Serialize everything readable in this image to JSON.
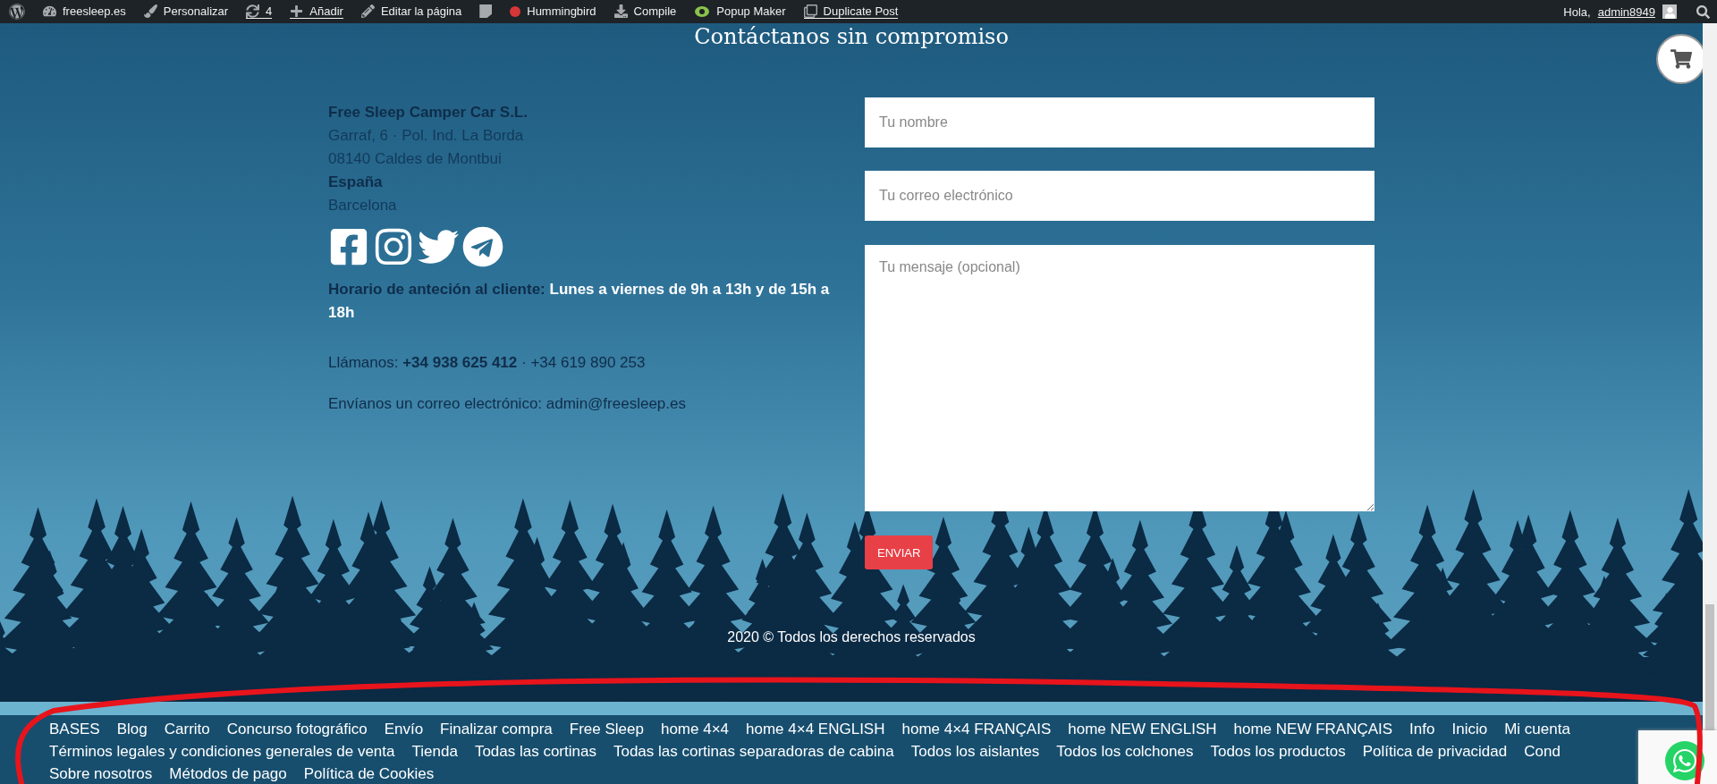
{
  "admin_bar": {
    "items": [
      {
        "kind": "wordpress",
        "underlined": false
      },
      {
        "kind": "dashboard",
        "label": "freesleep.es",
        "underlined": false
      },
      {
        "kind": "brush",
        "label": "Personalizar",
        "underlined": false
      },
      {
        "kind": "updates",
        "label": "4",
        "underlined": true
      },
      {
        "kind": "add",
        "label": "Añadir",
        "underlined": true
      },
      {
        "kind": "edit",
        "label": "Editar la página",
        "underlined": false
      },
      {
        "kind": "yoast",
        "underlined": false
      },
      {
        "kind": "status",
        "label": "Hummingbird",
        "underlined": false
      },
      {
        "kind": "compile",
        "label": "Compile",
        "underlined": false
      },
      {
        "kind": "popup",
        "label": "Popup Maker",
        "underlined": false
      },
      {
        "kind": "duplicate",
        "label": "Duplicate Post",
        "underlined": true
      }
    ],
    "greeting": "Hola,",
    "user": "admin8949"
  },
  "heading": "Contáctanos sin compromiso",
  "contact": {
    "address_lines": [
      {
        "text": "Free Sleep Camper Car S.L.",
        "bold": true
      },
      {
        "text": "Garraf, 6 · Pol. Ind. La Borda",
        "bold": false
      },
      {
        "text": "08140 Caldes de Montbui",
        "bold": false
      },
      {
        "text": "España",
        "bold": true
      },
      {
        "text": "Barcelona",
        "bold": false
      }
    ],
    "social": [
      {
        "kind": "facebook"
      },
      {
        "kind": "instagram"
      },
      {
        "kind": "twitter"
      },
      {
        "kind": "telegram"
      }
    ],
    "hours_label": "Horario de anteción al cliente:",
    "hours_value": "Lunes a viernes de 9h a 13h y de 15h a 18h",
    "phone": "Llámanos: **+34 938 625 412** · +34 619 890 253",
    "email": "Envíanos un correo electrónico: admin@freesleep.es"
  },
  "form": {
    "fields": [
      {
        "kind": "input",
        "placeholder": "Tu nombre"
      },
      {
        "kind": "input",
        "placeholder": "Tu correo electrónico"
      },
      {
        "kind": "textarea",
        "placeholder": "Tu mensaje (opcional)"
      }
    ],
    "submit": "ENVIAR"
  },
  "copyright": "2020 © Todos los derechos reservados",
  "footer_menu": {
    "items": [
      "BASES",
      "Blog",
      "Carrito",
      "Concurso fotográfico",
      "Envío",
      "Finalizar compra",
      "Free Sleep",
      "home 4×4",
      "home 4×4 ENGLISH",
      "home 4×4 FRANÇAIS",
      "home NEW ENGLISH",
      "home NEW FRANÇAIS",
      "Info",
      "Inicio",
      "Mi cuenta",
      "Términos legales y condiciones generales de venta",
      "Tienda",
      "Todas las cortinas",
      "Todas las cortinas separadoras de cabina",
      "Todos los aislantes",
      "Todos los colchones",
      "Todos los productos",
      "Política de privacidad",
      "Cond",
      "Sobre nosotros",
      "Métodos de pago",
      "Política de Cookies"
    ]
  }
}
